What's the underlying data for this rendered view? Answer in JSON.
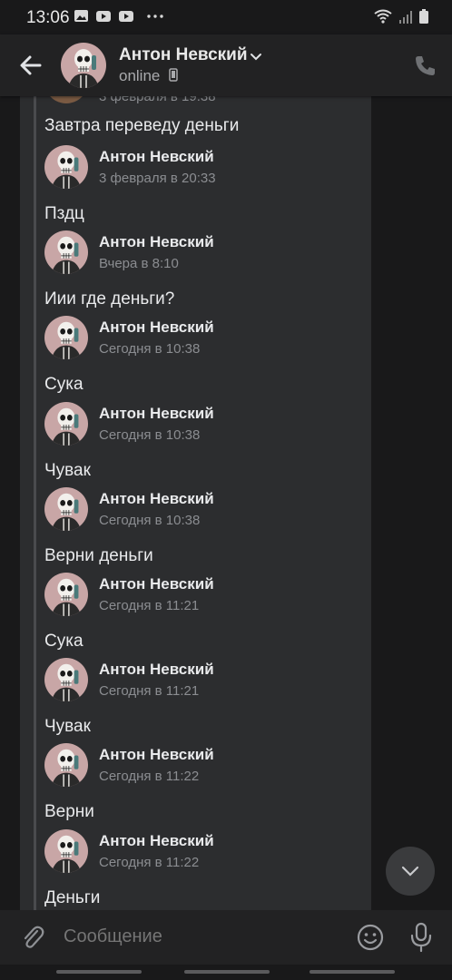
{
  "status_bar": {
    "time": "13:06"
  },
  "header": {
    "name": "Антон Невский",
    "status": "online"
  },
  "partial_top": {
    "time": "3 февраля в 19:38"
  },
  "messages": [
    {
      "text": "Завтра переведу деньги"
    },
    {
      "sender": "Антон Невский",
      "time": "3 февраля в 20:33",
      "text": "Пздц"
    },
    {
      "sender": "Антон Невский",
      "time": "Вчера в 8:10",
      "text": "Иии где деньги?"
    },
    {
      "sender": "Антон Невский",
      "time": "Сегодня в 10:38",
      "text": "Сука"
    },
    {
      "sender": "Антон Невский",
      "time": "Сегодня в 10:38",
      "text": "Чувак"
    },
    {
      "sender": "Антон Невский",
      "time": "Сегодня в 10:38",
      "text": "Верни деньги"
    },
    {
      "sender": "Антон Невский",
      "time": "Сегодня в 11:21",
      "text": "Сука"
    },
    {
      "sender": "Антон Невский",
      "time": "Сегодня в 11:21",
      "text": "Чувак"
    },
    {
      "sender": "Антон Невский",
      "time": "Сегодня в 11:22",
      "text": "Верни"
    },
    {
      "sender": "Антон Невский",
      "time": "Сегодня в 11:22",
      "text": "Деньги"
    }
  ],
  "composer": {
    "placeholder": "Сообщение"
  },
  "colors": {
    "background": "#19191a",
    "chat_bg": "#2c2d2f",
    "header_bg": "#222223",
    "avatar_bg": "#c8a6a6"
  },
  "icons": [
    "back-arrow-icon",
    "chevron-down-icon",
    "mobile-phone-icon",
    "phone-icon",
    "scroll-down-icon",
    "paperclip-icon",
    "emoji-icon",
    "microphone-icon"
  ]
}
